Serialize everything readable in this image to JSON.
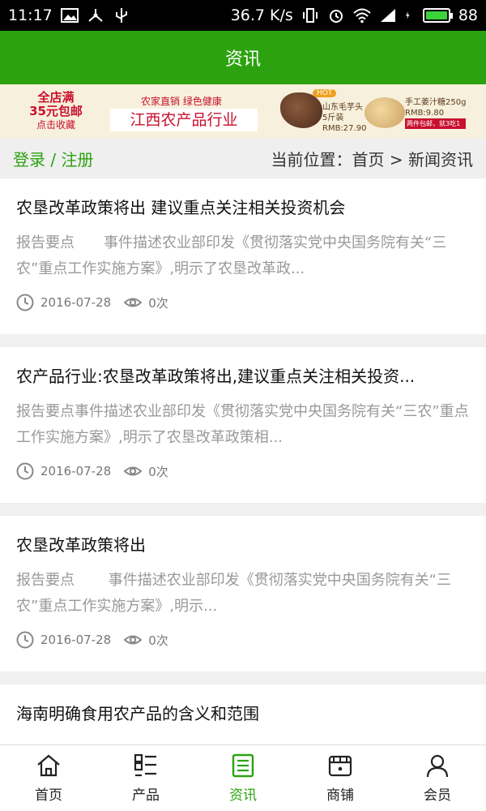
{
  "status": {
    "time": "11:17",
    "speed": "36.7 K/s",
    "battery": "88"
  },
  "header": {
    "title": "资讯"
  },
  "banner": {
    "promo_line1": "全店满",
    "promo_line2": "35元包邮",
    "promo_line3": "点击收藏",
    "tagline": "农家直销 绿色健康",
    "title": "江西农产品行业",
    "hot": "HOT",
    "product1_name": "山东毛芋头",
    "product1_spec": "5斤装",
    "product1_price": "RMB:27.90",
    "product2_name": "手工姜汁糖250g",
    "product2_price": "RMB:9.80",
    "product2_note": "两件包邮，就3吃1"
  },
  "locbar": {
    "login": "登录 / 注册",
    "location": "当前位置：首页 > 新闻资讯"
  },
  "articles": [
    {
      "title": "农垦改革政策将出 建议重点关注相关投资机会",
      "summary": "报告要点　　事件描述农业部印发《贯彻落实党中央国务院有关“三农”重点工作实施方案》,明示了农垦改革政...",
      "date": "2016-07-28",
      "views": "0次"
    },
    {
      "title": "农产品行业:农垦改革政策将出,建议重点关注相关投资...",
      "summary": "报告要点事件描述农业部印发《贯彻落实党中央国务院有关“三农”重点工作实施方案》,明示了农垦改革政策相...",
      "date": "2016-07-28",
      "views": "0次"
    },
    {
      "title": "农垦改革政策将出",
      "summary": " 报告要点　　 事件描述农业部印发《贯彻落实党中央国务院有关“三农”重点工作实施方案》,明示...",
      "date": "2016-07-28",
      "views": "0次"
    },
    {
      "title": "海南明确食用农产品的含义和范围"
    }
  ],
  "nav": [
    {
      "label": "首页",
      "icon": "home-icon"
    },
    {
      "label": "产品",
      "icon": "list-icon"
    },
    {
      "label": "资讯",
      "icon": "news-icon",
      "active": true
    },
    {
      "label": "商铺",
      "icon": "store-icon"
    },
    {
      "label": "会员",
      "icon": "user-icon"
    }
  ],
  "colors": {
    "brand_green": "#2ca210",
    "banner_bg": "#f7f0dc",
    "promo_red": "#c8102e"
  }
}
